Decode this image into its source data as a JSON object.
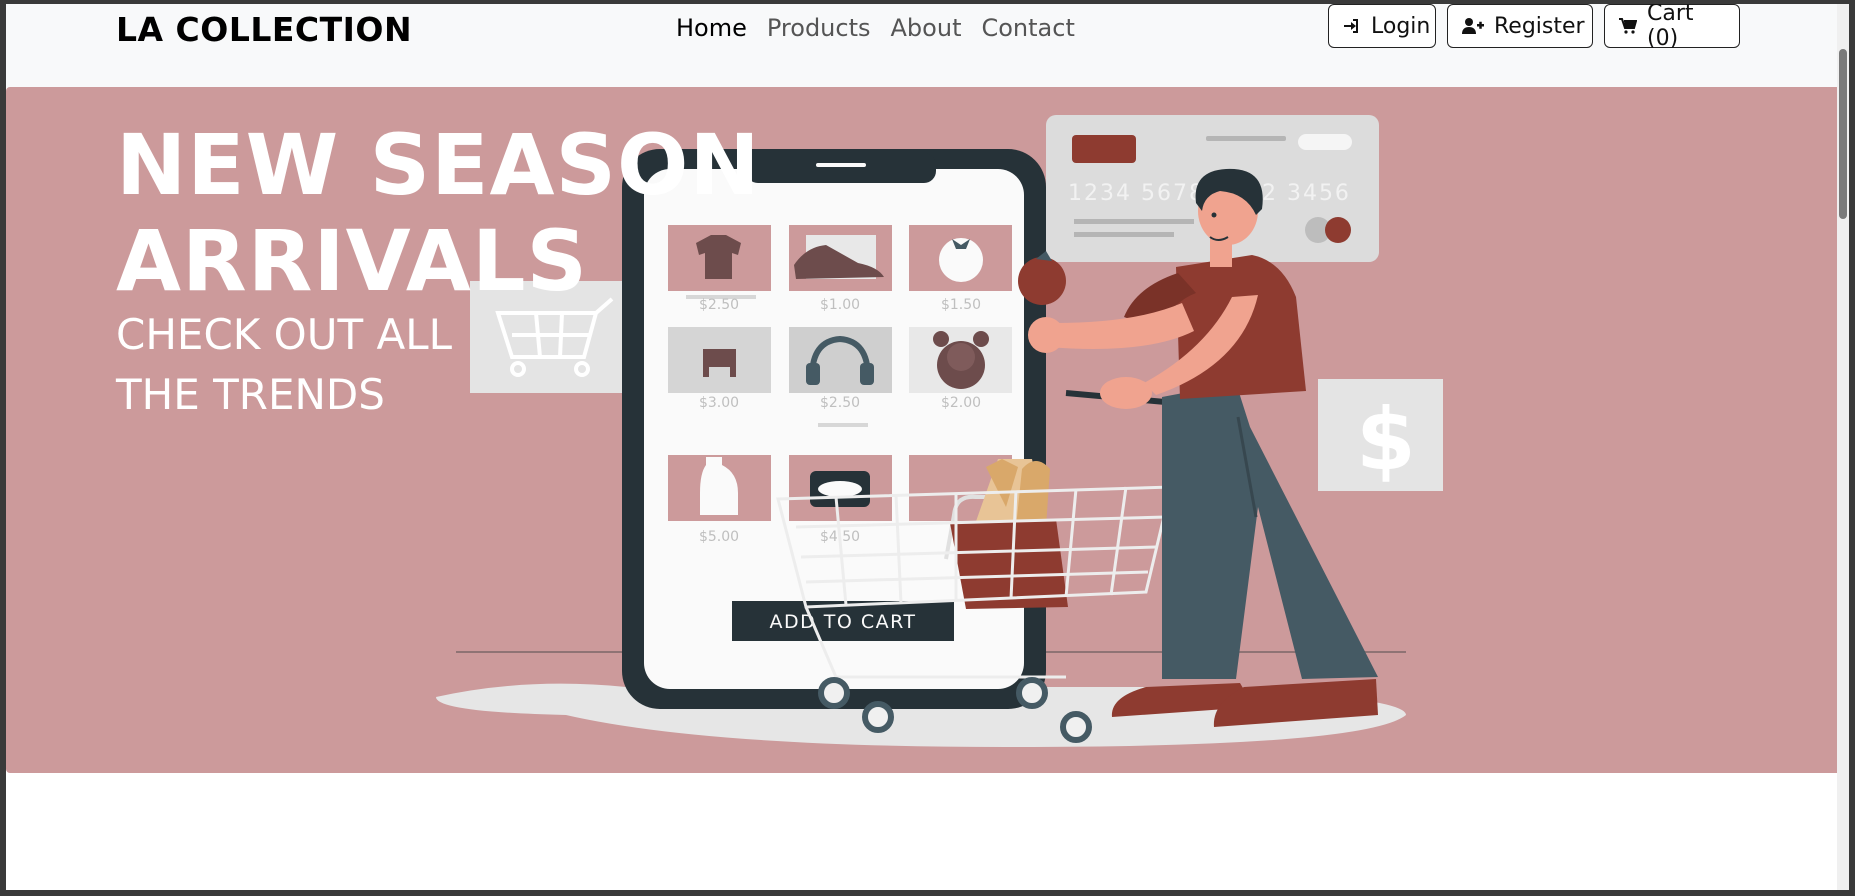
{
  "navbar": {
    "brand": "LA COLLECTION",
    "links": [
      {
        "label": "Home",
        "active": true
      },
      {
        "label": "Products",
        "active": false
      },
      {
        "label": "About",
        "active": false
      },
      {
        "label": "Contact",
        "active": false
      }
    ],
    "login_label": "Login",
    "register_label": "Register",
    "cart_label": "Cart (0)"
  },
  "hero": {
    "title_line1": "NEW SEASON",
    "title_line2": "ARRIVALS",
    "subtitle_line1": "CHECK OUT ALL",
    "subtitle_line2": "THE TRENDS",
    "background_color": "#cc9a9b",
    "illustration": {
      "card_number": "1234 5678 9012 3456",
      "cta_label": "ADD TO CART",
      "prices": [
        "$2.50",
        "$1.00",
        "$1.50",
        "$3.00",
        "$2.50",
        "$2.00",
        "$5.00",
        "$4.50"
      ],
      "product_icons": [
        "tshirt-icon",
        "sneaker-icon",
        "tomato-icon",
        "chair-icon",
        "headphones-icon",
        "teddy-bear-icon",
        "bottle-icon",
        "jar-icon",
        "lotion-icon"
      ]
    }
  },
  "colors": {
    "accent_brown": "#8e3b30",
    "dark_slate": "#263238",
    "pants": "#455a64",
    "skin": "#f0a38f"
  }
}
